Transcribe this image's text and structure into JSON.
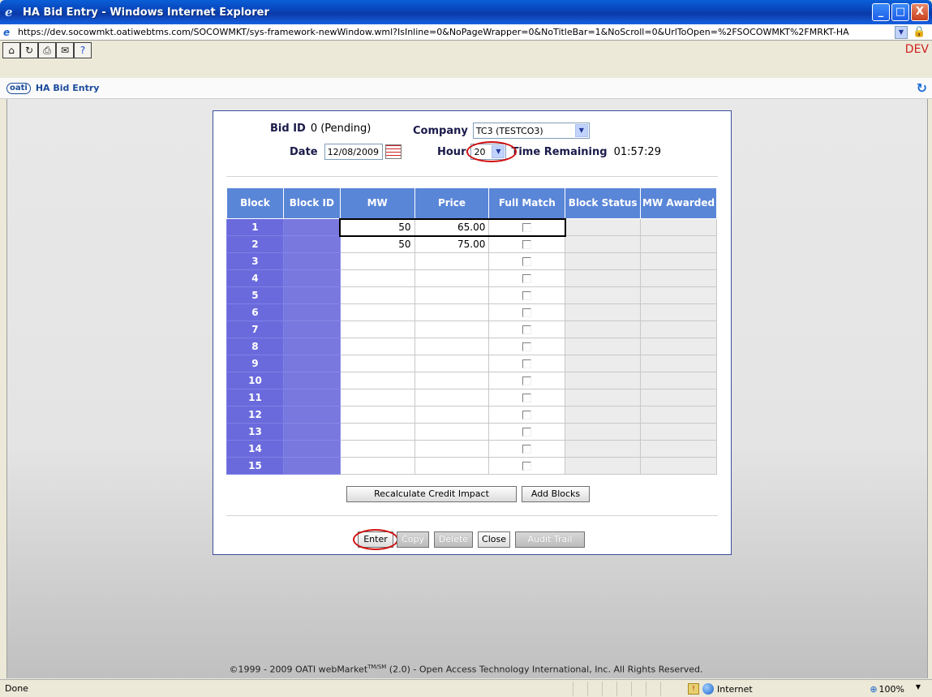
{
  "window": {
    "title": "HA Bid Entry - Windows Internet Explorer",
    "minimize": "_",
    "maximize": "□",
    "close": "X"
  },
  "address": {
    "url": "https://dev.socowmkt.oatiwebtms.com/SOCOWMKT/sys-framework-newWindow.wml?IsInline=0&NoPageWrapper=0&NoTitleBar=1&NoScroll=0&UrlToOpen=%2FSOCOWMKT%2FMRKT-HA",
    "dropdown": "▼"
  },
  "toolbar": {
    "buttons": [
      "⌂",
      "↻",
      "⎙",
      "✉",
      "?"
    ],
    "env_label": "DEV"
  },
  "app": {
    "logo": "oati",
    "name": "HA Bid Entry",
    "refresh": "↻"
  },
  "form": {
    "bid_id_label": "Bid ID",
    "bid_id_value": "0 (Pending)",
    "company_label": "Company",
    "company_value": "TC3 (TESTCO3)",
    "date_label": "Date",
    "date_value": "12/08/2009",
    "hour_label": "Hour",
    "hour_value": "20",
    "time_remaining_label": "Time Remaining",
    "time_remaining_value": "01:57:29"
  },
  "grid": {
    "headers": {
      "block": "Block",
      "block_id": "Block ID",
      "mw": "MW",
      "price": "Price",
      "full_match": "Full Match",
      "block_status": "Block Status",
      "mw_awarded": "MW Awarded"
    },
    "rows": [
      {
        "block": "1",
        "mw": "50",
        "price": "65.00"
      },
      {
        "block": "2",
        "mw": "50",
        "price": "75.00"
      },
      {
        "block": "3",
        "mw": "",
        "price": ""
      },
      {
        "block": "4",
        "mw": "",
        "price": ""
      },
      {
        "block": "5",
        "mw": "",
        "price": ""
      },
      {
        "block": "6",
        "mw": "",
        "price": ""
      },
      {
        "block": "7",
        "mw": "",
        "price": ""
      },
      {
        "block": "8",
        "mw": "",
        "price": ""
      },
      {
        "block": "9",
        "mw": "",
        "price": ""
      },
      {
        "block": "10",
        "mw": "",
        "price": ""
      },
      {
        "block": "11",
        "mw": "",
        "price": ""
      },
      {
        "block": "12",
        "mw": "",
        "price": ""
      },
      {
        "block": "13",
        "mw": "",
        "price": ""
      },
      {
        "block": "14",
        "mw": "",
        "price": ""
      },
      {
        "block": "15",
        "mw": "",
        "price": ""
      }
    ]
  },
  "actions": {
    "recalc": "Recalculate Credit Impact",
    "add_blocks": "Add Blocks",
    "enter": "Enter",
    "copy": "Copy",
    "delete": "Delete",
    "close": "Close",
    "audit_trail": "Audit Trail"
  },
  "footer": {
    "prefix": "©1999 - 2009 OATI webMarket",
    "tm": "TM/SM",
    "suffix": " (2.0) - Open Access Technology International, Inc. All Rights Reserved."
  },
  "status": {
    "text": "Done",
    "zone": "Internet",
    "zoom": "100%"
  }
}
